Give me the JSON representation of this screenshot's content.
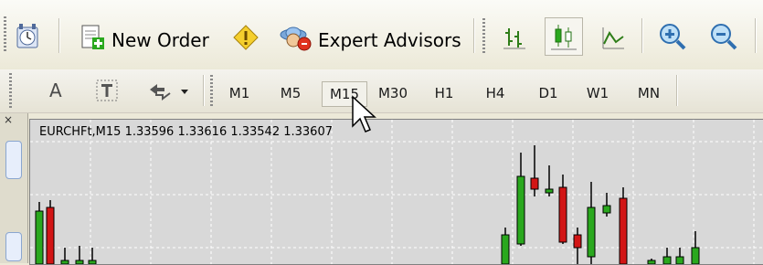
{
  "toolbar": {
    "new_order_label": "New Order",
    "expert_advisors_label": "Expert Advisors"
  },
  "timeframes": [
    "M1",
    "M5",
    "M15",
    "M30",
    "H1",
    "H4",
    "D1",
    "W1",
    "MN"
  ],
  "active_timeframe": "M15",
  "text_tool_label": "A",
  "chart": {
    "header": "EURCHFt,M15  1.33596 1.33616 1.33542 1.33607"
  },
  "colors": {
    "bull": "#2aa81e",
    "bear": "#d21515",
    "chart_bg": "#d8d8d8",
    "grid": "#ffffff"
  },
  "icons": [
    "clock-icon",
    "new-order-icon",
    "alert-icon",
    "expert-advisors-icon",
    "bar-chart-icon",
    "candle-chart-icon",
    "line-chart-icon",
    "zoom-in-icon",
    "zoom-out-icon",
    "text-label-icon",
    "arrows-icon",
    "mouse-cursor-icon"
  ]
}
